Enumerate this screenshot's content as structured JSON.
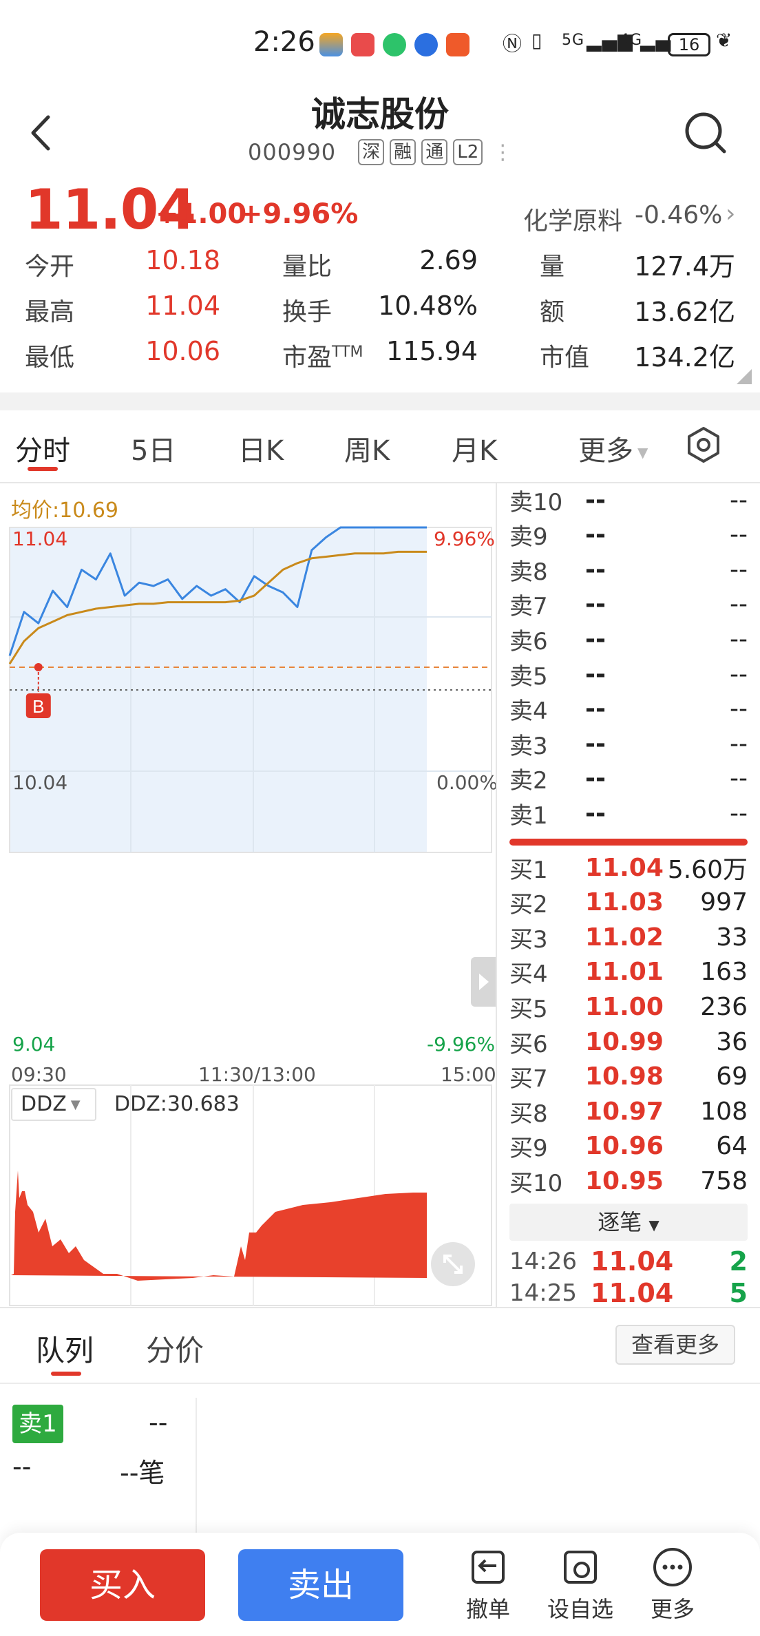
{
  "status_bar": {
    "time": "2:26",
    "network_1": "5G",
    "network_2": "4G",
    "battery": "16"
  },
  "header": {
    "stock_name": "诚志股份",
    "code": "000990",
    "tags": [
      "深",
      "融",
      "通",
      "L2"
    ]
  },
  "quote": {
    "price": "11.04",
    "change": "+1.00",
    "change_pct": "+9.96%",
    "sector_name": "化学原料",
    "sector_change": "-0.46%",
    "stats": {
      "open_label": "今开",
      "open": "10.18",
      "high_label": "最高",
      "high": "11.04",
      "low_label": "最低",
      "low": "10.06",
      "vol_ratio_label": "量比",
      "vol_ratio": "2.69",
      "turnover_label": "换手",
      "turnover": "10.48%",
      "pe_label": "市盈",
      "pe_sup": "TTM",
      "pe": "115.94",
      "volume_label": "量",
      "volume": "127.4万",
      "amount_label": "额",
      "amount": "13.62亿",
      "mktcap_label": "市值",
      "mktcap": "134.2亿"
    }
  },
  "tabs": {
    "items": [
      "分时",
      "5日",
      "日K",
      "周K",
      "月K"
    ],
    "more": "更多"
  },
  "chart": {
    "avg_label": "均价:10.69",
    "y_high": "11.04",
    "y_high_pct": "9.96%",
    "y_mid": "10.04",
    "y_mid_pct": "0.00%",
    "y_low": "9.04",
    "y_low_pct": "-9.96%",
    "x_start": "09:30",
    "x_mid": "11:30/13:00",
    "x_end": "15:00",
    "buy_marker": "B",
    "ddz_select": "DDZ",
    "ddz_value": "DDZ:30.683"
  },
  "chart_data": {
    "type": "line",
    "title": "",
    "xlabel": "",
    "ylabel": "",
    "ylim": [
      9.04,
      11.04
    ],
    "x": [
      "09:30",
      "11:30/13:00",
      "15:00"
    ],
    "series": [
      {
        "name": "",
        "color": "#3a86e0",
        "values": [
          10.25,
          10.52,
          10.45,
          10.65,
          10.55,
          10.78,
          10.72,
          10.88,
          10.62,
          10.7,
          10.68,
          10.72,
          10.6,
          10.68,
          10.62,
          10.66,
          10.58,
          10.74,
          10.68,
          10.64,
          10.55,
          10.9,
          10.98,
          11.04,
          11.04,
          11.04,
          11.04,
          11.04,
          11.04,
          11.04
        ]
      },
      {
        "name": "均价",
        "color": "#c98a1b",
        "values": [
          10.2,
          10.34,
          10.42,
          10.46,
          10.5,
          10.52,
          10.54,
          10.55,
          10.56,
          10.57,
          10.57,
          10.58,
          10.58,
          10.58,
          10.58,
          10.58,
          10.59,
          10.62,
          10.7,
          10.78,
          10.82,
          10.85,
          10.86,
          10.87,
          10.88,
          10.88,
          10.88,
          10.89,
          10.89,
          10.89
        ]
      }
    ],
    "reference_price": 10.04,
    "buy_price": 10.18
  },
  "order_book": {
    "sell": [
      {
        "label": "卖10",
        "price": "--",
        "vol": "--"
      },
      {
        "label": "卖9",
        "price": "--",
        "vol": "--"
      },
      {
        "label": "卖8",
        "price": "--",
        "vol": "--"
      },
      {
        "label": "卖7",
        "price": "--",
        "vol": "--"
      },
      {
        "label": "卖6",
        "price": "--",
        "vol": "--"
      },
      {
        "label": "卖5",
        "price": "--",
        "vol": "--"
      },
      {
        "label": "卖4",
        "price": "--",
        "vol": "--"
      },
      {
        "label": "卖3",
        "price": "--",
        "vol": "--"
      },
      {
        "label": "卖2",
        "price": "--",
        "vol": "--"
      },
      {
        "label": "卖1",
        "price": "--",
        "vol": "--"
      }
    ],
    "buy": [
      {
        "label": "买1",
        "price": "11.04",
        "vol": "5.60万"
      },
      {
        "label": "买2",
        "price": "11.03",
        "vol": "997"
      },
      {
        "label": "买3",
        "price": "11.02",
        "vol": "33"
      },
      {
        "label": "买4",
        "price": "11.01",
        "vol": "163"
      },
      {
        "label": "买5",
        "price": "11.00",
        "vol": "236"
      },
      {
        "label": "买6",
        "price": "10.99",
        "vol": "36"
      },
      {
        "label": "买7",
        "price": "10.98",
        "vol": "69"
      },
      {
        "label": "买8",
        "price": "10.97",
        "vol": "108"
      },
      {
        "label": "买9",
        "price": "10.96",
        "vol": "64"
      },
      {
        "label": "买10",
        "price": "10.95",
        "vol": "758"
      }
    ],
    "zhubi_label": "逐笔",
    "ticks": [
      {
        "time": "14:26",
        "price": "11.04",
        "vol": "2"
      },
      {
        "time": "14:25",
        "price": "11.04",
        "vol": "5"
      }
    ]
  },
  "queue": {
    "tab_queue": "队列",
    "tab_price": "分价",
    "see_more": "查看更多",
    "sell1": "卖1",
    "sell1_val": "--",
    "left_dash": "--",
    "right_dash": "--笔"
  },
  "bottom_bar": {
    "buy": "买入",
    "sell": "卖出",
    "cancel": "撤单",
    "watchlist": "设自选",
    "more": "更多"
  },
  "colors": {
    "up": "#e1372a",
    "down": "#16a34a",
    "line": "#3a86e0",
    "avg": "#c98a1b",
    "sell_btn": "#3f7ff0"
  }
}
